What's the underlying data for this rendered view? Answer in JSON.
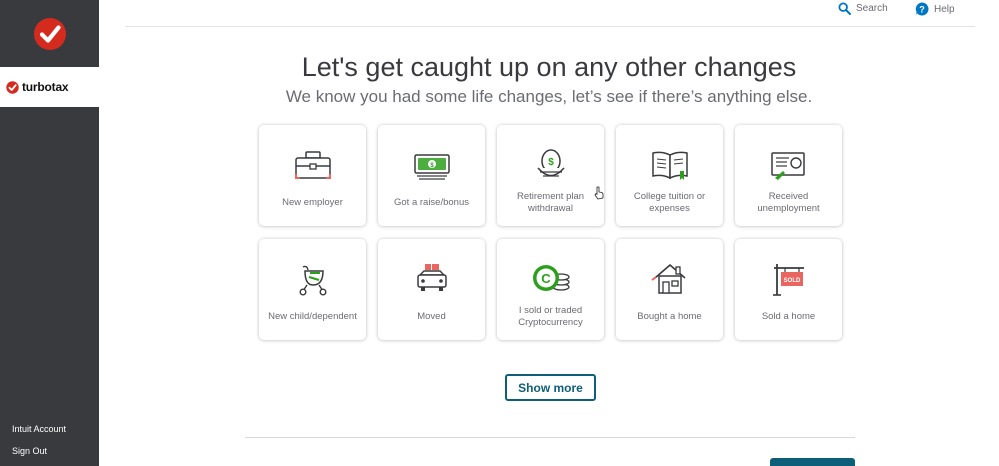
{
  "sidebar": {
    "brand_name": "turbotax",
    "links": [
      "Intuit Account",
      "Sign Out"
    ]
  },
  "header": {
    "search_label": "Search",
    "help_label": "Help"
  },
  "main": {
    "title": "Let's get caught up on any other changes",
    "subtitle": "We know you had some life changes, let’s see if there’s anything else.",
    "tiles": [
      {
        "label": "New employer",
        "icon": "briefcase-icon"
      },
      {
        "label": "Got a raise/bonus",
        "icon": "cash-icon"
      },
      {
        "label": "Retirement plan withdrawal",
        "icon": "nest-egg-icon"
      },
      {
        "label": "College tuition or expenses",
        "icon": "book-icon"
      },
      {
        "label": "Received unemployment",
        "icon": "certificate-icon"
      },
      {
        "label": "New child/dependent",
        "icon": "stroller-icon"
      },
      {
        "label": "Moved",
        "icon": "moving-car-icon"
      },
      {
        "label": "I sold or traded Cryptocurrency",
        "icon": "crypto-coin-icon"
      },
      {
        "label": "Bought a home",
        "icon": "house-icon"
      },
      {
        "label": "Sold a home",
        "icon": "sold-sign-icon"
      }
    ],
    "show_more_label": "Show more"
  },
  "colors": {
    "sidebar_bg": "#393a3d",
    "accent": "#0d5f79",
    "brand_red": "#d52b1e",
    "icon_green": "#2ca01c",
    "icon_coral": "#e8665f"
  }
}
